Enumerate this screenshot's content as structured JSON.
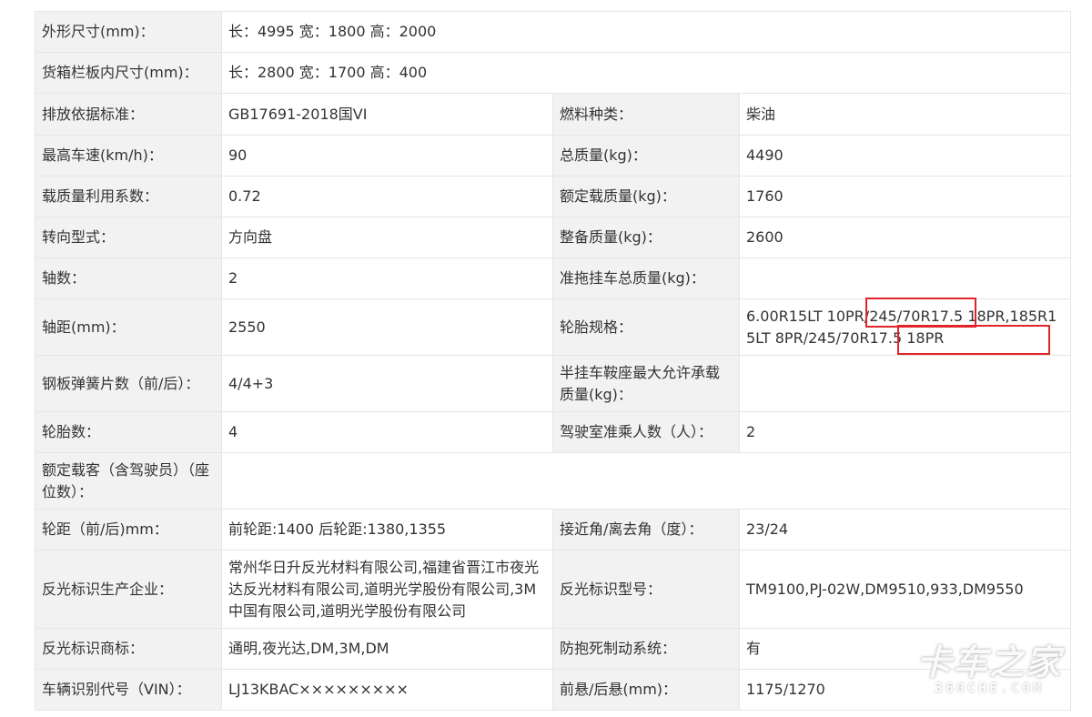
{
  "spec": {
    "dimensions_label": "外形尺寸(mm)：",
    "dimensions_value": "长：4995 宽：1800 高：2000",
    "cargo_box_label": "货箱栏板内尺寸(mm)：",
    "cargo_box_value": "长：2800 宽：1700 高：400",
    "emission_label": "排放依据标准：",
    "emission_value": "GB17691-2018国VI",
    "fuel_label": "燃料种类：",
    "fuel_value": "柴油",
    "max_speed_label": "最高车速(km/h)：",
    "max_speed_value": "90",
    "gross_mass_label": "总质量(kg)：",
    "gross_mass_value": "4490",
    "load_factor_label": "载质量利用系数：",
    "load_factor_value": "0.72",
    "rated_load_label": "额定载质量(kg)：",
    "rated_load_value": "1760",
    "steering_label": "转向型式：",
    "steering_value": "方向盘",
    "curb_mass_label": "整备质量(kg)：",
    "curb_mass_value": "2600",
    "axles_label": "轴数：",
    "axles_value": "2",
    "trailer_mass_label": "准拖挂车总质量(kg)：",
    "trailer_mass_value": "",
    "wheelbase_label": "轴距(mm)：",
    "wheelbase_value": "2550",
    "tyre_spec_label": "轮胎规格：",
    "tyre_spec_value": "6.00R15LT 10PR/245/70R17.5 18PR,185R15LT 8PR/245/70R17.5 18PR",
    "leaf_spring_label": "钢板弹簧片数（前/后）：",
    "leaf_spring_value": "4/4+3",
    "saddle_load_label": "半挂车鞍座最大允许承载质量(kg)：",
    "saddle_load_value": "",
    "tyre_count_label": "轮胎数：",
    "tyre_count_value": "4",
    "cab_passengers_label": "驾驶室准乘人数（人）：",
    "cab_passengers_value": "2",
    "rated_passengers_label": "额定载客（含驾驶员）（座位数）：",
    "rated_passengers_value": "",
    "track_label": "轮距（前/后)mm：",
    "track_value": "前轮距:1400 后轮距:1380,1355",
    "angle_label": "接近角/离去角（度）：",
    "angle_value": "23/24",
    "reflector_maker_label": "反光标识生产企业：",
    "reflector_maker_value": "常州华日升反光材料有限公司,福建省晋江市夜光达反光材料有限公司,道明光学股份有限公司,3M中国有限公司,道明光学股份有限公司",
    "reflector_model_label": "反光标识型号：",
    "reflector_model_value": "TM9100,PJ-02W,DM9510,933,DM9550",
    "reflector_brand_label": "反光标识商标：",
    "reflector_brand_value": "通明,夜光达,DM,3M,DM",
    "abs_label": "防抱死制动系统：",
    "abs_value": "有",
    "vin_label": "车辆识别代号（VIN）：",
    "vin_value": "LJ13KBAC×××××××××",
    "overhang_label": "前悬/后悬(mm)：",
    "overhang_value": "1175/1270"
  },
  "watermark": {
    "logo_text": "卡车之家",
    "sub_text": "360CHE.COM"
  },
  "colors": {
    "label_bg": "#f2f2f2",
    "border": "#e6e6e6",
    "text": "#333333",
    "highlight": "#e0242a"
  }
}
